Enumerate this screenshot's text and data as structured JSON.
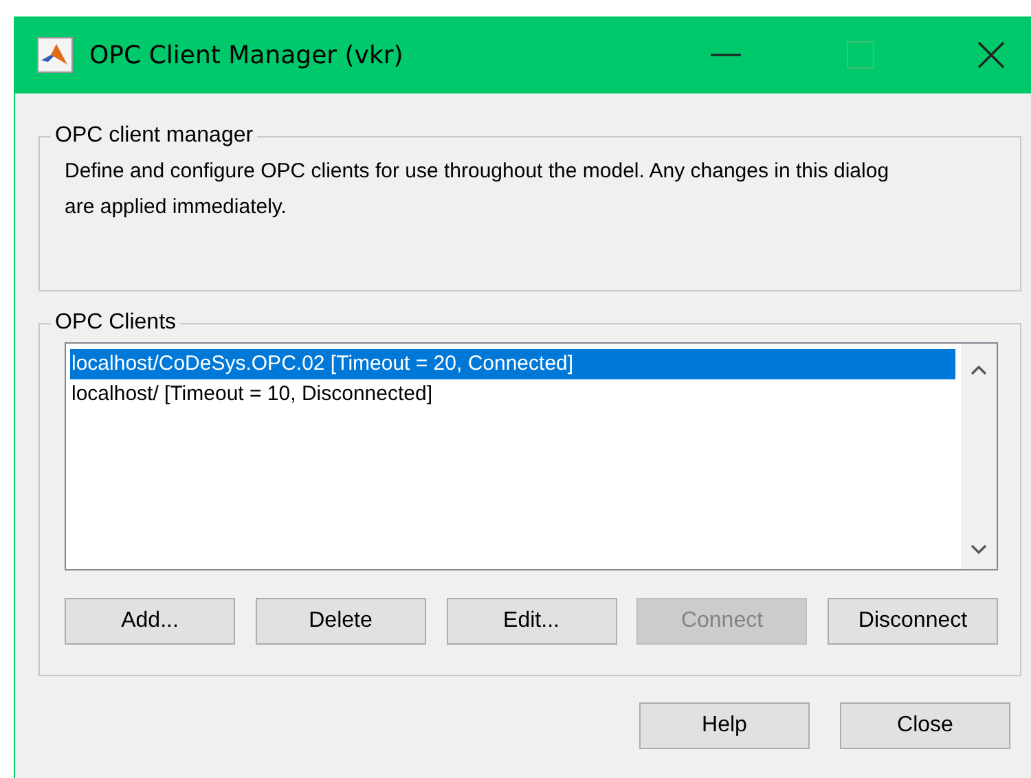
{
  "window": {
    "title": "OPC Client Manager (vkr)"
  },
  "manager_group": {
    "title": "OPC client manager",
    "description": "Define and configure OPC clients for use throughout the model. Any changes in this dialog are applied immediately."
  },
  "clients_group": {
    "title": "OPC Clients",
    "clients": [
      {
        "label": "localhost/CoDeSys.OPC.02 [Timeout = 20, Connected]",
        "selected": true
      },
      {
        "label": "localhost/ [Timeout = 10, Disconnected]",
        "selected": false
      }
    ],
    "buttons": [
      {
        "label": "Add...",
        "disabled": false
      },
      {
        "label": "Delete",
        "disabled": false
      },
      {
        "label": "Edit...",
        "disabled": false
      },
      {
        "label": "Connect",
        "disabled": true
      },
      {
        "label": "Disconnect",
        "disabled": false
      }
    ]
  },
  "dialog_buttons": [
    {
      "label": "Help"
    },
    {
      "label": "Close"
    }
  ]
}
